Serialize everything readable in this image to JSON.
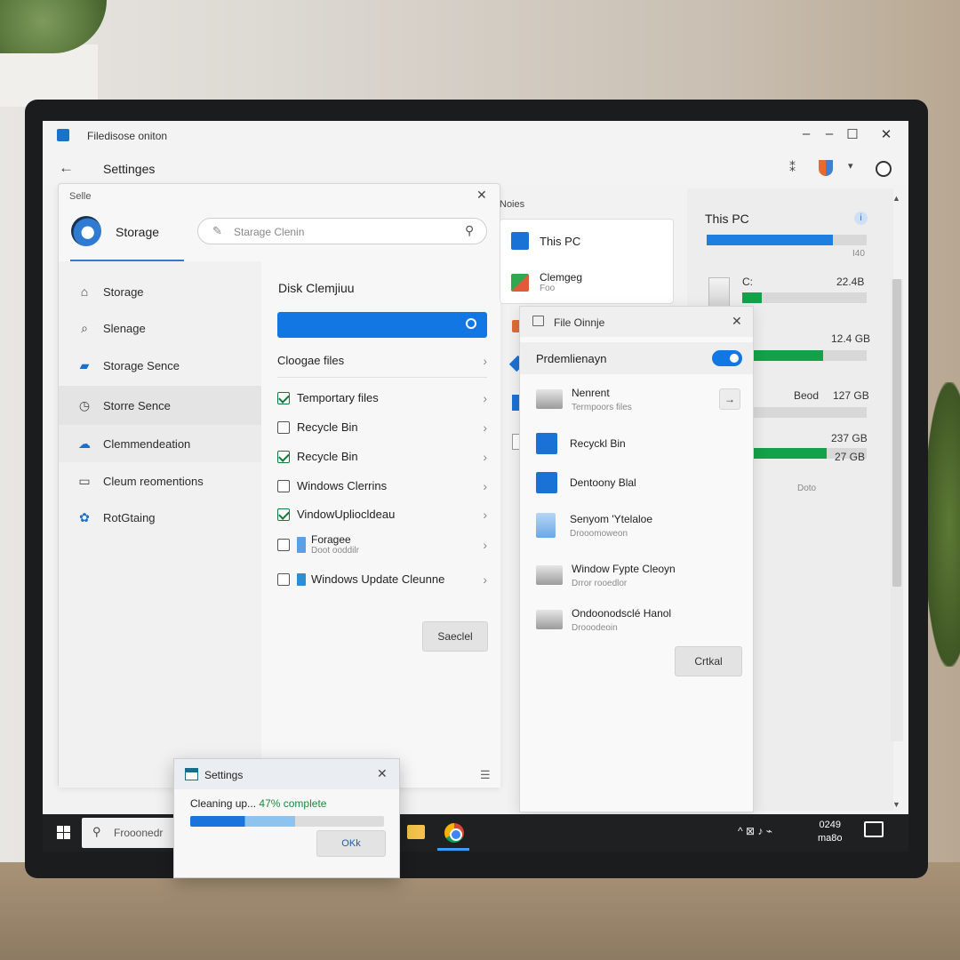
{
  "window": {
    "title": "Filedisose oniton",
    "minimize": "–",
    "maximize": "☐",
    "close": "✕"
  },
  "nav": {
    "back": "←",
    "title": "Settinges"
  },
  "settings_panel": {
    "label": "Selle",
    "close": "✕",
    "heading": "Storage",
    "search_placeholder": "Starage Clenin",
    "sidebar": [
      {
        "label": "Storage",
        "icon": "home-icon",
        "glyph": "⌂"
      },
      {
        "label": "Slenage",
        "icon": "search-icon",
        "glyph": "⌕"
      },
      {
        "label": "Storage Sence",
        "icon": "storage-icon",
        "glyph": "▰"
      },
      {
        "label": "Storre Sence",
        "icon": "clock-icon",
        "glyph": "◷"
      },
      {
        "label": "Clemmendeation",
        "icon": "cloud-icon",
        "glyph": "☁"
      },
      {
        "label": "Cleum reomentions",
        "icon": "drive-icon",
        "glyph": "▭"
      },
      {
        "label": "RotGtaing",
        "icon": "flower-icon",
        "glyph": "✿"
      }
    ],
    "content": {
      "title": "Disk Clemjiuu",
      "section": "Cloogae files",
      "rows": [
        {
          "label": "Temportary files",
          "checked": true
        },
        {
          "label": "Recycle Bin",
          "checked": false
        },
        {
          "label": "Recycle Bin",
          "checked": true
        },
        {
          "label": "Windows Clerrins",
          "checked": false
        },
        {
          "label": "VindowUpliocldeau",
          "checked": true
        },
        {
          "label": "Foragee",
          "sub": "Doot ooddilr",
          "checked": false
        },
        {
          "label": "Windows Update Cleunne",
          "checked": false
        }
      ],
      "button": "Saeclel"
    }
  },
  "notes": {
    "label": "Noies",
    "items": [
      {
        "label": "This PC"
      },
      {
        "label": "Clemgeg",
        "sub": "Foo"
      }
    ]
  },
  "right_pane": {
    "title": "This PC",
    "info": "i",
    "top_bar_value": "I40",
    "drive_letter": "C:",
    "drives": [
      {
        "size": "22.4B",
        "used_fraction": 0.16,
        "color": "#13a14a"
      },
      {
        "size": "12.4 GB",
        "used_fraction": 0.65,
        "color": "#13a14a"
      },
      {
        "size": "127 GB",
        "label": "Beod",
        "used_fraction": 0.0,
        "color": "#13a14a"
      },
      {
        "size": "237 GB",
        "size2": "27 GB",
        "used_fraction": 0.68,
        "color": "#13a14a"
      }
    ],
    "footer": "Doto",
    "top_bar_fraction": 0.79
  },
  "file_cleanup": {
    "title": "File Oinnje",
    "close": "✕",
    "band_label": "Prdemlienayn",
    "items": [
      {
        "title": "Nenrent",
        "sub": "Termpoors files",
        "icon": "drive-icon"
      },
      {
        "title": "Recyckl Bin",
        "sub": "",
        "icon": "monitor-icon"
      },
      {
        "title": "Dentoony Blal",
        "sub": "",
        "icon": "monitor-icon"
      },
      {
        "title": "Senyom 'Ytelaloe",
        "sub": "Drooomoweon",
        "icon": "document-icon"
      },
      {
        "title": "Window Fypte Cleoyn",
        "sub": "Drror rooedlor",
        "icon": "drive-icon"
      },
      {
        "title": "Ondoonodsclé Hanol",
        "sub": "Drooodeoin",
        "icon": "drive-icon"
      }
    ],
    "arrow": "→",
    "button": "Crtkal"
  },
  "taskbar": {
    "search_text": "Frooonedr",
    "search_icon": "⚲",
    "tray": "^ ⊠ ♪ ⌁",
    "time": "0249",
    "date": "ma8o"
  },
  "toast": {
    "title": "Settings",
    "close": "✕",
    "msg_prefix": "Cleaning up...",
    "msg_percent": "47% complete",
    "progress": 0.47,
    "button": "OKk"
  }
}
